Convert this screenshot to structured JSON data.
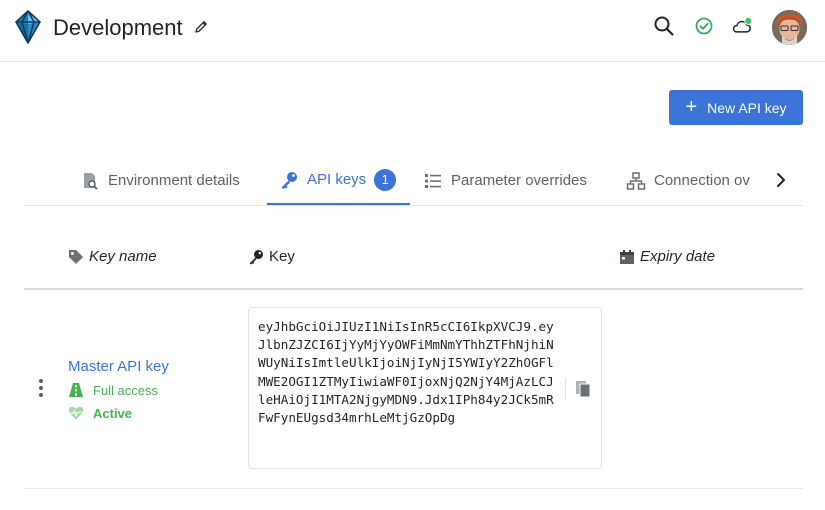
{
  "header": {
    "title": "Development",
    "icons": [
      "logo-icon",
      "edit-icon",
      "search-icon",
      "check-circle-icon",
      "cloud-icon",
      "avatar"
    ]
  },
  "actions": {
    "new_api_key_label": "New API key"
  },
  "tabs": [
    {
      "label": "Environment details",
      "icon": "document-search-icon"
    },
    {
      "label": "API keys",
      "icon": "key-icon",
      "badge": "1",
      "active": true
    },
    {
      "label": "Parameter overrides",
      "icon": "list-icon"
    },
    {
      "label": "Connection ov",
      "icon": "network-icon"
    }
  ],
  "table": {
    "columns": [
      {
        "label": "Key name",
        "icon": "tag-icon"
      },
      {
        "label": "Key",
        "icon": "key-icon"
      },
      {
        "label": "Expiry date",
        "icon": "calendar-icon"
      }
    ],
    "rows": [
      {
        "name": "Master API key",
        "access": "Full access",
        "status": "Active",
        "key": "eyJhbGciOiJIUzI1NiIsInR5cCI6IkpXVCJ9.eyJlbnZJZCI6IjYyMjYyOWFiMmNmYThhZTFhNjhiNWUyNiIsImtleUlkIjoiNjIyNjI5YWIyY2ZhOGFlMWE2OGI1ZTMyIiwiaWF0IjoxNjQ2NjY4MjAzLCJleHAiOjI1MTA2NjgyMDN9.Jdx1IPh84y2JCk5mRFwFynEUgsd34mrhLeMtjGzOpDg",
        "expiry": ""
      }
    ]
  },
  "colors": {
    "accent": "#3b73d9",
    "success": "#4caf50",
    "border": "#e3e5e8"
  }
}
